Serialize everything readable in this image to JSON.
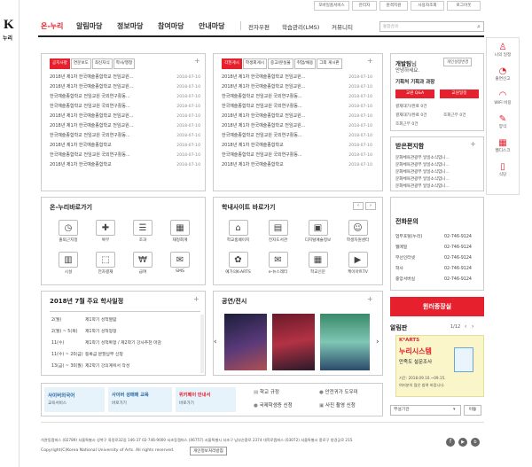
{
  "header": {
    "logo_k": "K",
    "logo_name": "누리",
    "util": [
      "모바일홈서비스",
      "관리자",
      "원격지원",
      "사용자조회",
      "로그아웃"
    ],
    "gnb": [
      "온-누리",
      "알림마당",
      "정보마당",
      "참여마당",
      "안내마당"
    ],
    "sub": [
      "전자우편",
      "학습관리(LMS)",
      "커뮤니티"
    ],
    "search_placeholder": "통합검색"
  },
  "notice": {
    "tabs": [
      "공지사항",
      "연문보도",
      "최신자식",
      "학사/행정"
    ],
    "rows": [
      {
        "t": "2018년 제1차 한국예술종합학교 전임교원...",
        "d": "2018-07-10"
      },
      {
        "t": "2018년 제1차 한국예술종합학교 전임교원...",
        "d": "2018-07-10"
      },
      {
        "t": "한국예술종합학교 전임교원 국외연구활동...",
        "d": "2018-07-10"
      },
      {
        "t": "한국예술종합학교 전임교원 국외연구활동...",
        "d": "2018-07-10"
      },
      {
        "t": "2018년 제1차 한국예술종합학교 전임교원...",
        "d": "2018-07-10"
      },
      {
        "t": "2018년 제1차 한국예술종합학교 전임교원...",
        "d": "2018-07-10"
      },
      {
        "t": "한국예술종합학교 전임교원 국외연구활동...",
        "d": "2018-07-10"
      },
      {
        "t": "2018년 제1차 한국예술종합학교",
        "d": "2018-07-10"
      },
      {
        "t": "한국예술종합학교 전임교원 국외연구활동...",
        "d": "2018-07-10"
      },
      {
        "t": "2018년 제1차 한국예술종합학교",
        "d": "2018-07-10"
      }
    ]
  },
  "board": {
    "tabs": [
      "각현게시",
      "학생회게시",
      "중고/분실물",
      "취업/채용",
      "그외 게시판"
    ],
    "rows": [
      {
        "t": "2018년 제1차 한국예술종합학교 전임교원...",
        "d": "2018-07-10"
      },
      {
        "t": "2018년 제1차 한국예술종합학교 전임교원...",
        "d": "2018-07-10"
      },
      {
        "t": "한국예술종합학교 전임교원 국외연구활동...",
        "d": "2018-07-10"
      },
      {
        "t": "한국예술종합학교 전임교원 국외연구활동...",
        "d": "2018-07-10"
      },
      {
        "t": "2018년 제1차 한국예술종합학교 전임교원...",
        "d": "2018-07-10"
      },
      {
        "t": "2018년 제1차 한국예술종합학교 전임교원...",
        "d": "2018-07-10"
      },
      {
        "t": "한국예술종합학교 전임교원 국외연구활동...",
        "d": "2018-07-10"
      },
      {
        "t": "2018년 제1차 한국예술종합학교",
        "d": "2018-07-10"
      },
      {
        "t": "한국예술종합학교 전임교원 국외연구활동...",
        "d": "2018-07-10"
      },
      {
        "t": "2018년 제1차 한국예술종합학교",
        "d": "2018-07-10"
      }
    ]
  },
  "user": {
    "name": "개발팀",
    "suffix": "님",
    "greet": "안녕하세요.",
    "dept": "기획처 기획과 과장",
    "btn_qna": "교원 Q&A",
    "btn_sched": "교원일정",
    "personal": "개인설정변경",
    "stats": [
      "결재대기/완료 0건",
      "결재대기/완료 0건",
      "조회근무 0건",
      "조회근무 0건"
    ]
  },
  "inbox": {
    "title": "받은편지함",
    "rows": [
      "문화체육관광부 일일소식입니...",
      "문화체육관광부 일일소식입니...",
      "문화체육관광부 일일소식입니...",
      "문화체육관광부 일일소식입니...",
      "문화체육관광부 일일소식입니..."
    ]
  },
  "onnuri": {
    "title": "온-누리바로가기",
    "items": [
      "출퇴근지정",
      "복무",
      "조과",
      "재정회계",
      "시설",
      "전자결재",
      "급여",
      "SMS"
    ]
  },
  "sites": {
    "title": "학내사이트 바로가기",
    "items": [
      "학교홈페이지",
      "전자도서관",
      "디지털예술정보",
      "학생지원센터",
      "예가의K-ARTS",
      "e-뉴스레터",
      "학교신문",
      "케이아트TV"
    ]
  },
  "phone": {
    "title": "전화문의",
    "rows": [
      {
        "k": "업무포털(누리)",
        "v": "02-746-9124"
      },
      {
        "k": "웹메일",
        "v": "02-746-9124"
      },
      {
        "k": "무선인터넷",
        "v": "02-746-9124"
      },
      {
        "k": "학사",
        "v": "02-746-9124"
      },
      {
        "k": "중앙서버실",
        "v": "02-746-9124"
      }
    ]
  },
  "schedule": {
    "title": "2018년 7월 주요 학사일정",
    "rows": [
      {
        "d": "2(월)",
        "t": "제1학기 성적열람"
      },
      {
        "d": "2(월) ~ 5(목)",
        "t": "제1학기 성적정정"
      },
      {
        "d": "11(수)",
        "t": "제1학기 성적확정 / 제2학기 강사추천 마감"
      },
      {
        "d": "11(수) ~ 20(금)",
        "t": "등록금 분할납부 신청"
      },
      {
        "d": "13(금) ~ 30(월)",
        "t": "제2학기 강의계획서 작성"
      }
    ]
  },
  "perf": {
    "title": "공연/전시",
    "posters": [
      "",
      "",
      ""
    ]
  },
  "banner_red": "원러종장실",
  "alarm": {
    "title": "알림판",
    "page": "1/12",
    "brand": "K*ARTS",
    "line1": "누리시스템",
    "line2": "만족도 설문조사",
    "line3": "기간: 2018.09.10.~09.15.",
    "line4": "여러분의 많은 참여 바랍니다."
  },
  "bottom": {
    "b1a": "사이버외국어",
    "b1b": "교육서비스",
    "b2a": "사이버 성매매 교육",
    "b2b": "바로가기",
    "b3a": "위키페이 안내서",
    "b3b": "바로가기",
    "l1": "학교 규정",
    "l2": "안전귀가 도우미",
    "l3": "국제학생증 신청",
    "l4": "사진 촬영 신청",
    "select": "부설기관",
    "go": "이동"
  },
  "quick": [
    "나의 일정",
    "출면신고",
    "WiFi 비용",
    "양식",
    "웹디스크",
    "식당"
  ],
  "footer": {
    "addr": "석관동캠퍼스 (02789) 서울특별시 성북구 화랑로32길 146-37 02-746-9000   서초동캠퍼스 (06757) 서울특별시 서초구 남부순환로 2374   대학로캠퍼스 (03072) 서울특별시 종로구 창경궁로 215",
    "copy": "Copyright(C)Korea National University of Arts. All rights reserved.",
    "privacy": "개인정보처리방침"
  }
}
